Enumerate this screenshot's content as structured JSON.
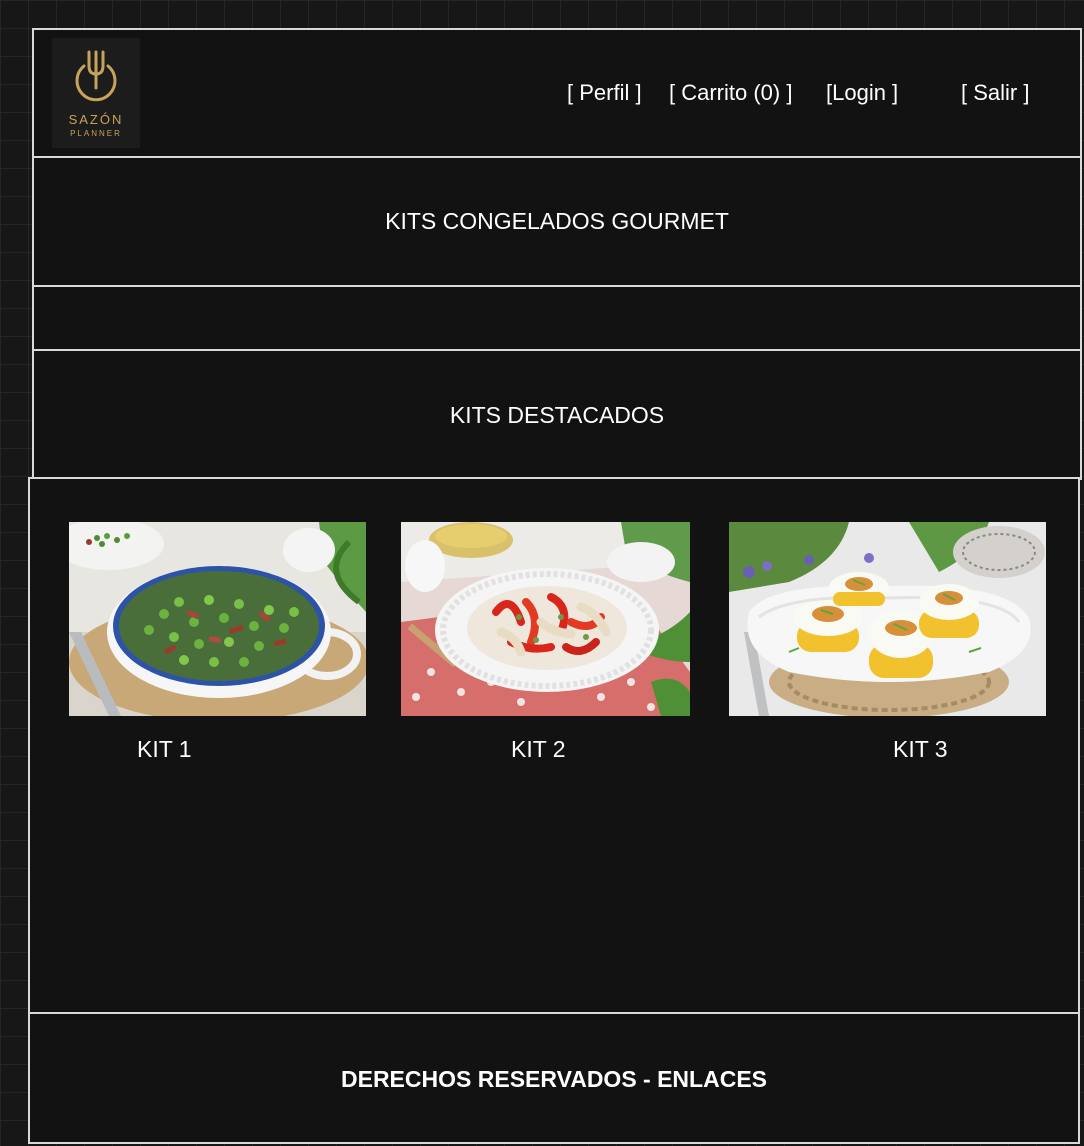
{
  "header": {
    "logo": {
      "brand": "SAZÓN",
      "tagline": "PLANNER",
      "icon": "fork-power-icon"
    },
    "nav": {
      "perfil": "[ Perfil ]",
      "carrito": "[ Carrito (0) ]",
      "login": "[Login ]",
      "salir": "[ Salir ]"
    }
  },
  "banner": {
    "title": "KITS CONGELADOS GOURMET"
  },
  "featured": {
    "title": "KITS DESTACADOS",
    "kits": [
      {
        "label": "KIT 1",
        "image": "peas-with-ham-dish-image"
      },
      {
        "label": "KIT 2",
        "image": "roasted-peppers-dish-image"
      },
      {
        "label": "KIT 3",
        "image": "stuffed-eggs-dish-image"
      }
    ]
  },
  "footer": {
    "text": "DERECHOS RESERVADOS - ENLACES"
  },
  "colors": {
    "background": "#121212",
    "border": "#d9d9d9",
    "text": "#ffffff",
    "logo_gold": "#c7a35a"
  }
}
